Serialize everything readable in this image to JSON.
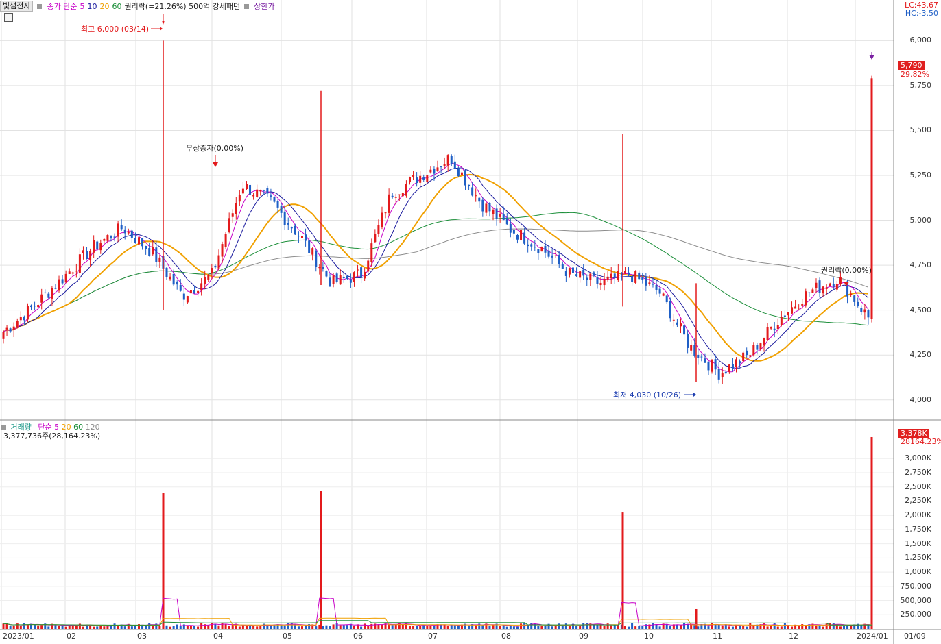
{
  "stock": {
    "name": "빛샘전자"
  },
  "price_legend": {
    "label": "종가 단순",
    "periods": [
      "5",
      "10",
      "20",
      "60"
    ],
    "overlay": "권리락(=21.26%) 500억 강세패턴",
    "limit_up": "상한가"
  },
  "lc_hc": {
    "lc": "LC:43.67",
    "hc": "HC:-3.50"
  },
  "current": {
    "price": "5,790",
    "change": "29.82%"
  },
  "annotations": {
    "high": "최고 6,000 (03/14)",
    "low": "최저 4,030 (10/26)",
    "bonus_issue": "무상증자(0.00%)",
    "ex_rights": "권리락(0.00%)"
  },
  "volume_legend": {
    "label": "거래량",
    "ma_label": "단순",
    "periods": [
      "5",
      "20",
      "60",
      "120"
    ],
    "value": "3,377,736주(28,164.23%)"
  },
  "volume_current": {
    "value": "3,378K",
    "pct": "28164.23%"
  },
  "price_axis": [
    "6,000",
    "5,750",
    "5,500",
    "5,250",
    "5,000",
    "4,750",
    "4,500",
    "4,250",
    "4,000"
  ],
  "volume_axis": [
    "3,000K",
    "2,750K",
    "2,500K",
    "2,250K",
    "2,000K",
    "1,750K",
    "1,500K",
    "1,250K",
    "1,000K",
    "750,000",
    "500,000",
    "250,000"
  ],
  "x_axis": [
    "2023/01",
    "02",
    "03",
    "04",
    "05",
    "06",
    "07",
    "08",
    "09",
    "10",
    "11",
    "12",
    "2024/01",
    "01/09"
  ],
  "colors": {
    "up": "#e31a1c",
    "down": "#1f5fc6",
    "ma5": "#c800c8",
    "ma10": "#1a1a9e",
    "ma20": "#f0a000",
    "ma60": "#1c8f3a",
    "ma120": "#8c8c8c"
  },
  "chart_data": {
    "type": "candlestick",
    "price_range": [
      3900,
      6150
    ],
    "volume_range": [
      0,
      3450000
    ],
    "x_months": [
      "2023/01",
      "02",
      "03",
      "04",
      "05",
      "06",
      "07",
      "08",
      "09",
      "10",
      "11",
      "12",
      "2024/01"
    ],
    "close_path": [
      [
        "2023/01",
        4380
      ],
      [
        "2023/01",
        4520
      ],
      [
        "02",
        4680
      ],
      [
        "02",
        4850
      ],
      [
        "02",
        4960
      ],
      [
        "03",
        4820
      ],
      [
        "03",
        4580
      ],
      [
        "03",
        4700
      ],
      [
        "04",
        5200
      ],
      [
        "04",
        5100
      ],
      [
        "04",
        4900
      ],
      [
        "05",
        4650
      ],
      [
        "05",
        4700
      ],
      [
        "05",
        5150
      ],
      [
        "06",
        5250
      ],
      [
        "06",
        5350
      ],
      [
        "06",
        5100
      ],
      [
        "07",
        4950
      ],
      [
        "07",
        4850
      ],
      [
        "08",
        4700
      ],
      [
        "08",
        4650
      ],
      [
        "09",
        4700
      ],
      [
        "09",
        4600
      ],
      [
        "10",
        4300
      ],
      [
        "10",
        4150
      ],
      [
        "11",
        4250
      ],
      [
        "11",
        4450
      ],
      [
        "12",
        4600
      ],
      [
        "12",
        4680
      ],
      [
        "2024/01",
        4460
      ],
      [
        "2024/01",
        5790
      ]
    ],
    "volume_spikes": [
      {
        "x": "03/14",
        "value": 2400000
      },
      {
        "x": "05",
        "value": 2430000
      },
      {
        "x": "09",
        "value": 2050000
      },
      {
        "x": "10",
        "value": 350000
      },
      {
        "x": "2024/01",
        "value": 3377736
      }
    ]
  }
}
